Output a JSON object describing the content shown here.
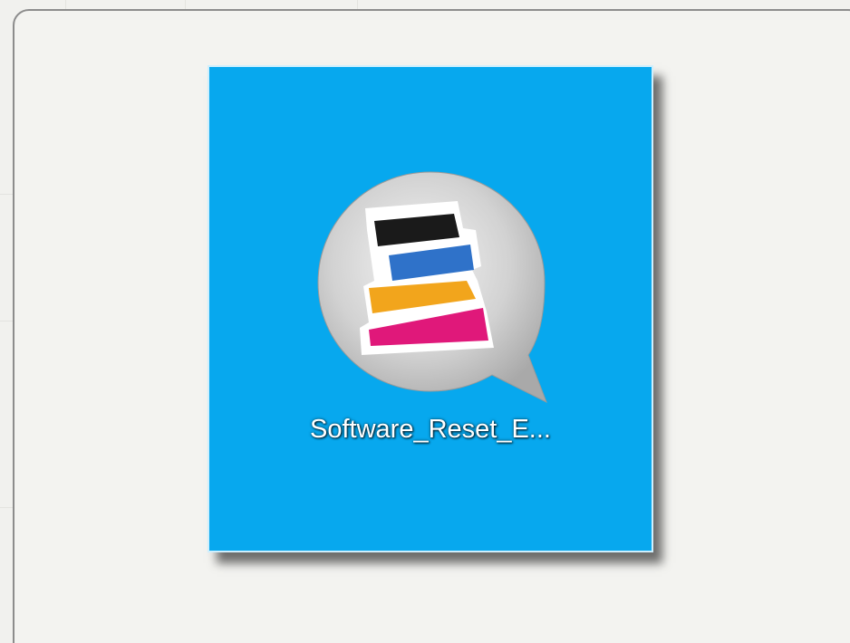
{
  "desktop": {
    "selected_icon": {
      "label": "Software_Reset_E...",
      "icon_name": "ink-stack-chat-bubble-icon",
      "selected": true,
      "highlight_color": "#07a8ee"
    }
  },
  "colors": {
    "background": "#f1f1ee",
    "panel_border": "#8c8c8c",
    "bubble_gray": "#c8c8c8",
    "ink_black": "#1a1a1a",
    "ink_blue": "#2f72c9",
    "ink_yellow": "#f2a51c",
    "ink_magenta": "#e0187a"
  }
}
